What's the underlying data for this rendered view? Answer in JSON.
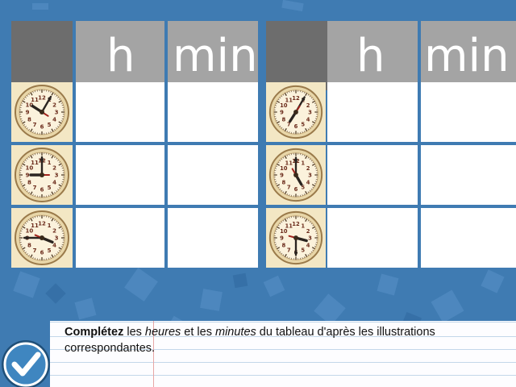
{
  "table": {
    "col_hours": "h",
    "col_minutes": "min"
  },
  "instruction": {
    "bold": "Complétez",
    "t1": " les ",
    "i1": "heures",
    "t2": " et les ",
    "i2": "minutes",
    "t3": " du tableau d'après les illustrations correspondantes."
  },
  "clocks": [
    {
      "hour": 10,
      "minute": 5
    },
    {
      "hour": 9,
      "minute": 0
    },
    {
      "hour": 3,
      "minute": 45
    },
    {
      "hour": 7,
      "minute": 5
    },
    {
      "hour": 5,
      "minute": 0
    },
    {
      "hour": 3,
      "minute": 30
    }
  ],
  "colors": {
    "background": "#3f7bb2",
    "header_dark": "#6d6d6d",
    "header_light": "#a4a4a4",
    "clock_face": "#f3e7c4",
    "check_button": "#2f6f9e"
  },
  "icons": [
    "checkmark-icon",
    "clock-icon"
  ]
}
